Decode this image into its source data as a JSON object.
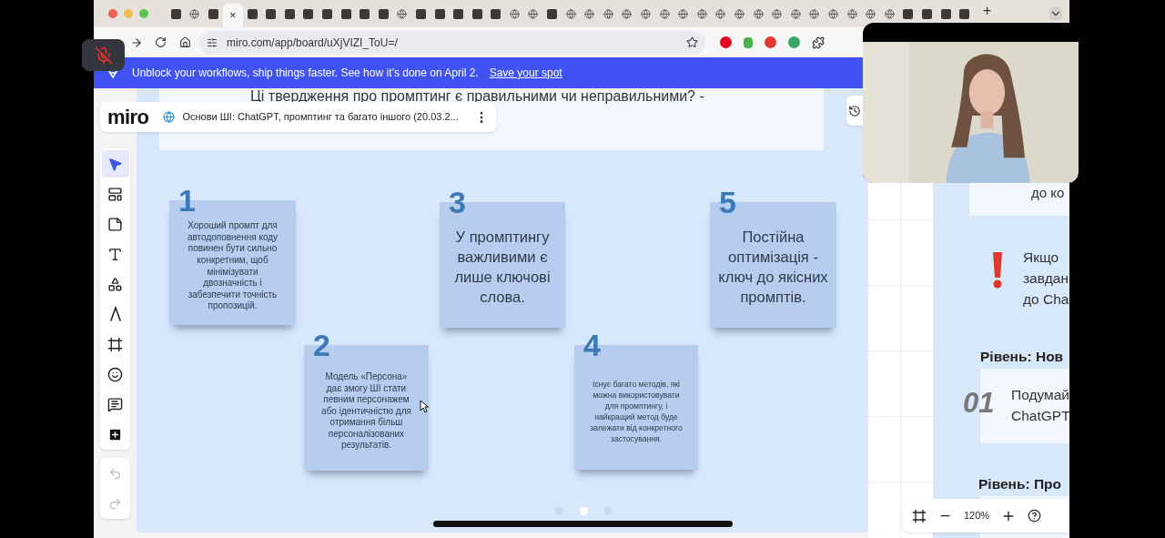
{
  "tab_bar": {
    "close_glyph": "×",
    "new_tab": "+",
    "tabs": [
      {
        "kind": "site",
        "selected": false
      },
      {
        "kind": "globe",
        "selected": false
      },
      {
        "kind": "site",
        "selected": false
      },
      {
        "selected": true
      },
      {
        "kind": "site",
        "selected": false
      },
      {
        "kind": "site",
        "selected": false
      },
      {
        "kind": "site",
        "selected": false
      },
      {
        "kind": "site",
        "selected": false
      },
      {
        "kind": "site",
        "selected": false
      },
      {
        "kind": "site",
        "selected": false
      },
      {
        "kind": "site",
        "selected": false
      },
      {
        "kind": "site",
        "selected": false
      },
      {
        "kind": "globe",
        "selected": false
      },
      {
        "kind": "site",
        "selected": false
      },
      {
        "kind": "site",
        "selected": false
      },
      {
        "kind": "site",
        "selected": false
      },
      {
        "kind": "site",
        "selected": false
      },
      {
        "kind": "site",
        "selected": false
      },
      {
        "kind": "globe",
        "selected": false
      },
      {
        "kind": "globe",
        "selected": false
      },
      {
        "kind": "site",
        "selected": false
      },
      {
        "kind": "globe",
        "selected": false
      },
      {
        "kind": "globe",
        "selected": false
      },
      {
        "kind": "globe",
        "selected": false
      },
      {
        "kind": "globe",
        "selected": false
      },
      {
        "kind": "globe",
        "selected": false
      },
      {
        "kind": "globe",
        "selected": false
      },
      {
        "kind": "globe",
        "selected": false
      },
      {
        "kind": "globe",
        "selected": false
      },
      {
        "kind": "globe",
        "selected": false
      },
      {
        "kind": "globe",
        "selected": false
      },
      {
        "kind": "globe",
        "selected": false
      },
      {
        "kind": "globe",
        "selected": false
      },
      {
        "kind": "globe",
        "selected": false
      },
      {
        "kind": "globe",
        "selected": false
      },
      {
        "kind": "globe",
        "selected": false
      },
      {
        "kind": "globe",
        "selected": false
      },
      {
        "kind": "globe",
        "selected": false
      },
      {
        "kind": "globe",
        "selected": false
      },
      {
        "kind": "site",
        "selected": false
      },
      {
        "kind": "site",
        "selected": false
      },
      {
        "kind": "site",
        "selected": false
      },
      {
        "kind": "site",
        "selected": false
      }
    ]
  },
  "address_bar": {
    "url": "miro.com/app/board/uXjVIZI_ToU=/"
  },
  "banner": {
    "text": "Unblock your workflows, ship things faster. See how it’s done on April 2.",
    "link": "Save your spot"
  },
  "board": {
    "logo": "miro",
    "title": "Основи ШІ: ChatGPT, промптинг та багато іншого (20.03.2...",
    "slide_title": "Ці твердження про промптинг є правильними чи неправильними? -",
    "tools": [
      {
        "kind": "select",
        "selected": true
      },
      {
        "kind": "templates",
        "selected": false
      },
      {
        "kind": "sticky",
        "selected": false
      },
      {
        "kind": "text",
        "selected": false
      },
      {
        "kind": "shapes",
        "selected": false
      },
      {
        "kind": "pen",
        "selected": false
      },
      {
        "kind": "frame",
        "selected": false
      },
      {
        "kind": "reactions",
        "selected": false
      },
      {
        "kind": "comment",
        "selected": false
      },
      {
        "kind": "more",
        "selected": false
      }
    ],
    "history": [
      {
        "kind": "undo",
        "disabled": true
      },
      {
        "kind": "redo",
        "disabled": true
      }
    ],
    "stickies": [
      {
        "number": "1",
        "kind": "detail",
        "text": "Хороший промпт для автодоповнення коду повинен бути сильно конкретним, щоб мінімізувати двозначність і забезпечити точність пропозицій."
      },
      {
        "number": "2",
        "kind": "detail",
        "text": "Модель «Персона» дає змогу ШІ стати певним персонажем або ідентичністю для отримання більш персоналізованих результатів."
      },
      {
        "number": "3",
        "kind": "statement",
        "text": "У промптингу важливими є лише ключові слова."
      },
      {
        "number": "4",
        "kind": "fine",
        "text": "Існує багато методів, які можна використовувати для промптингу, і найкращий метод буде залежати від конкретного застосування."
      },
      {
        "number": "5",
        "kind": "statement",
        "text": "Постійна оптимізація - ключ до якісних промптів."
      }
    ],
    "pager": [
      {
        "selected": false
      },
      {
        "selected": true
      },
      {
        "selected": false
      }
    ],
    "side_panel": {
      "card_text": "до ко",
      "warning_lines": [
        "Якщо",
        "завдан",
        "до Cha"
      ],
      "level_1": "Рівень: Нов",
      "step_number": "01",
      "step_lines": [
        "Подумай",
        "ChatGPT"
      ],
      "level_2": "Рівень: Про"
    },
    "zoom": "120%"
  },
  "call": {
    "mic_muted": true
  }
}
